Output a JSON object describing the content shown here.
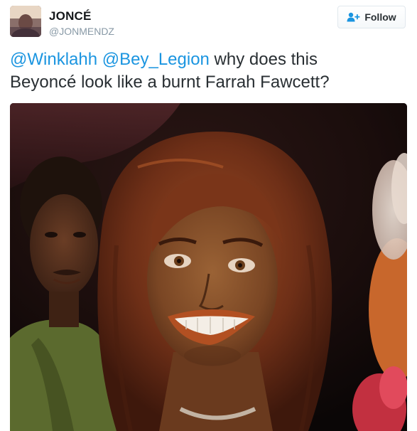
{
  "tweet": {
    "author": {
      "display_name": "JONCÉ",
      "screen_name": "@JONMENDZ",
      "avatar_icon": "profile-photo-avatar"
    },
    "follow_button": {
      "label": "Follow",
      "icon": "add-user-icon"
    },
    "text": {
      "mention_1": "@Winklahh",
      "mention_2": "@Bey_Legion",
      "body_line_1": " why does this",
      "body_line_2": "Beyoncé look like a burnt Farrah Fawcett?"
    },
    "media": {
      "description_icon": "wax-figure-photo"
    }
  },
  "colors": {
    "link": "#1b95e0",
    "text": "#292f33",
    "muted": "#8899a6",
    "button_border": "#e1e8ed"
  }
}
